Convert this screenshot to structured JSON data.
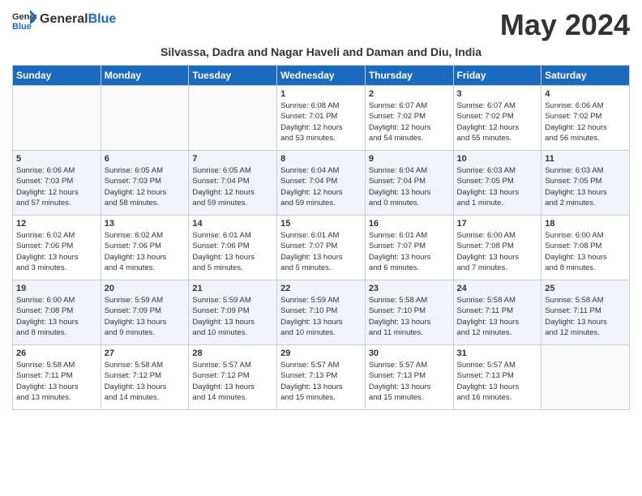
{
  "header": {
    "logo_general": "General",
    "logo_blue": "Blue",
    "month_year": "May 2024",
    "subtitle": "Silvassa, Dadra and Nagar Haveli and Daman and Diu, India"
  },
  "days_of_week": [
    "Sunday",
    "Monday",
    "Tuesday",
    "Wednesday",
    "Thursday",
    "Friday",
    "Saturday"
  ],
  "weeks": [
    [
      {
        "day": "",
        "info": ""
      },
      {
        "day": "",
        "info": ""
      },
      {
        "day": "",
        "info": ""
      },
      {
        "day": "1",
        "info": "Sunrise: 6:08 AM\nSunset: 7:01 PM\nDaylight: 12 hours\nand 53 minutes."
      },
      {
        "day": "2",
        "info": "Sunrise: 6:07 AM\nSunset: 7:02 PM\nDaylight: 12 hours\nand 54 minutes."
      },
      {
        "day": "3",
        "info": "Sunrise: 6:07 AM\nSunset: 7:02 PM\nDaylight: 12 hours\nand 55 minutes."
      },
      {
        "day": "4",
        "info": "Sunrise: 6:06 AM\nSunset: 7:02 PM\nDaylight: 12 hours\nand 56 minutes."
      }
    ],
    [
      {
        "day": "5",
        "info": "Sunrise: 6:06 AM\nSunset: 7:03 PM\nDaylight: 12 hours\nand 57 minutes."
      },
      {
        "day": "6",
        "info": "Sunrise: 6:05 AM\nSunset: 7:03 PM\nDaylight: 12 hours\nand 58 minutes."
      },
      {
        "day": "7",
        "info": "Sunrise: 6:05 AM\nSunset: 7:04 PM\nDaylight: 12 hours\nand 59 minutes."
      },
      {
        "day": "8",
        "info": "Sunrise: 6:04 AM\nSunset: 7:04 PM\nDaylight: 12 hours\nand 59 minutes."
      },
      {
        "day": "9",
        "info": "Sunrise: 6:04 AM\nSunset: 7:04 PM\nDaylight: 13 hours\nand 0 minutes."
      },
      {
        "day": "10",
        "info": "Sunrise: 6:03 AM\nSunset: 7:05 PM\nDaylight: 13 hours\nand 1 minute."
      },
      {
        "day": "11",
        "info": "Sunrise: 6:03 AM\nSunset: 7:05 PM\nDaylight: 13 hours\nand 2 minutes."
      }
    ],
    [
      {
        "day": "12",
        "info": "Sunrise: 6:02 AM\nSunset: 7:06 PM\nDaylight: 13 hours\nand 3 minutes."
      },
      {
        "day": "13",
        "info": "Sunrise: 6:02 AM\nSunset: 7:06 PM\nDaylight: 13 hours\nand 4 minutes."
      },
      {
        "day": "14",
        "info": "Sunrise: 6:01 AM\nSunset: 7:06 PM\nDaylight: 13 hours\nand 5 minutes."
      },
      {
        "day": "15",
        "info": "Sunrise: 6:01 AM\nSunset: 7:07 PM\nDaylight: 13 hours\nand 5 minutes."
      },
      {
        "day": "16",
        "info": "Sunrise: 6:01 AM\nSunset: 7:07 PM\nDaylight: 13 hours\nand 6 minutes."
      },
      {
        "day": "17",
        "info": "Sunrise: 6:00 AM\nSunset: 7:08 PM\nDaylight: 13 hours\nand 7 minutes."
      },
      {
        "day": "18",
        "info": "Sunrise: 6:00 AM\nSunset: 7:08 PM\nDaylight: 13 hours\nand 8 minutes."
      }
    ],
    [
      {
        "day": "19",
        "info": "Sunrise: 6:00 AM\nSunset: 7:08 PM\nDaylight: 13 hours\nand 8 minutes."
      },
      {
        "day": "20",
        "info": "Sunrise: 5:59 AM\nSunset: 7:09 PM\nDaylight: 13 hours\nand 9 minutes."
      },
      {
        "day": "21",
        "info": "Sunrise: 5:59 AM\nSunset: 7:09 PM\nDaylight: 13 hours\nand 10 minutes."
      },
      {
        "day": "22",
        "info": "Sunrise: 5:59 AM\nSunset: 7:10 PM\nDaylight: 13 hours\nand 10 minutes."
      },
      {
        "day": "23",
        "info": "Sunrise: 5:58 AM\nSunset: 7:10 PM\nDaylight: 13 hours\nand 11 minutes."
      },
      {
        "day": "24",
        "info": "Sunrise: 5:58 AM\nSunset: 7:11 PM\nDaylight: 13 hours\nand 12 minutes."
      },
      {
        "day": "25",
        "info": "Sunrise: 5:58 AM\nSunset: 7:11 PM\nDaylight: 13 hours\nand 12 minutes."
      }
    ],
    [
      {
        "day": "26",
        "info": "Sunrise: 5:58 AM\nSunset: 7:11 PM\nDaylight: 13 hours\nand 13 minutes."
      },
      {
        "day": "27",
        "info": "Sunrise: 5:58 AM\nSunset: 7:12 PM\nDaylight: 13 hours\nand 14 minutes."
      },
      {
        "day": "28",
        "info": "Sunrise: 5:57 AM\nSunset: 7:12 PM\nDaylight: 13 hours\nand 14 minutes."
      },
      {
        "day": "29",
        "info": "Sunrise: 5:57 AM\nSunset: 7:13 PM\nDaylight: 13 hours\nand 15 minutes."
      },
      {
        "day": "30",
        "info": "Sunrise: 5:57 AM\nSunset: 7:13 PM\nDaylight: 13 hours\nand 15 minutes."
      },
      {
        "day": "31",
        "info": "Sunrise: 5:57 AM\nSunset: 7:13 PM\nDaylight: 13 hours\nand 16 minutes."
      },
      {
        "day": "",
        "info": ""
      }
    ]
  ]
}
